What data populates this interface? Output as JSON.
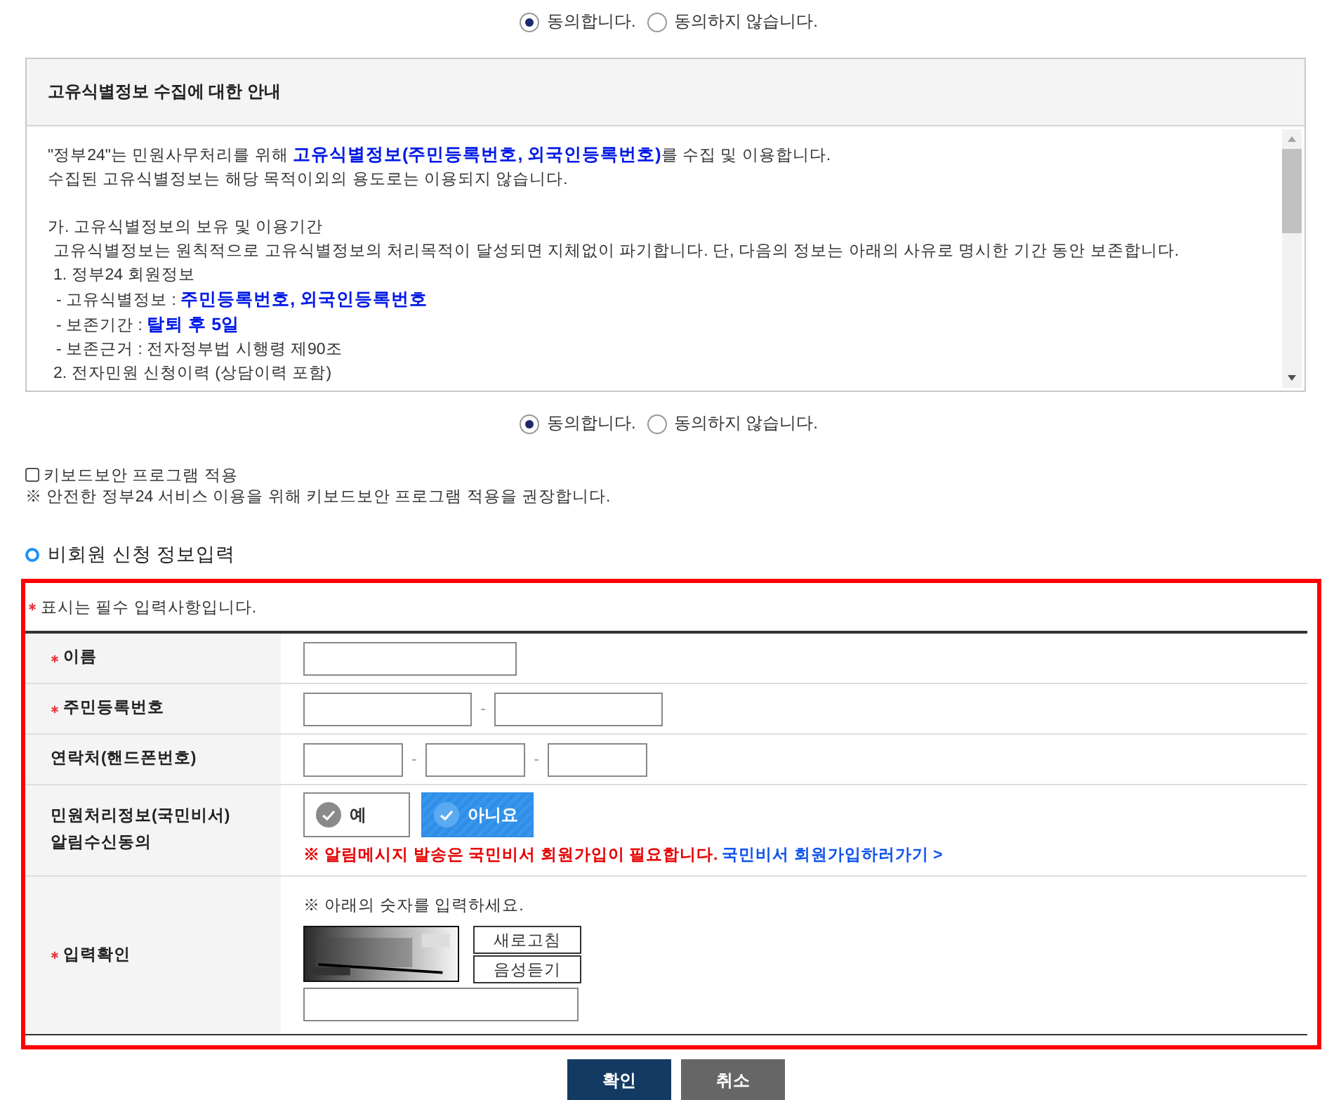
{
  "consent_top": {
    "options": [
      {
        "label": "동의합니다.",
        "selected": true
      },
      {
        "label": "동의하지 않습니다.",
        "selected": false
      }
    ]
  },
  "notice": {
    "title": "고유식별정보 수집에 대한 안내",
    "paragraphs": [
      {
        "lines": [
          {
            "kind": "plain",
            "text": "\"정부24\"는 민원사무처리를 위해 **고유식별정보(주민등록번호, 외국인등록번호)**를 수집 및 이용합니다."
          },
          {
            "kind": "plain",
            "text": "수집된 고유식별정보는 해당 목적이외의 용도로는 이용되지 않습니다."
          }
        ]
      },
      {
        "lines": [
          {
            "kind": "plain",
            "text": "가. 고유식별정보의 보유 및 이용기간"
          },
          {
            "kind": "indent",
            "text": "고유식별정보는 원칙적으로 고유식별정보의 처리목적이 달성되면 지체없이 파기합니다. 단, 다음의 정보는 아래의 사유로 명시한 기간 동안 보존합니다."
          },
          {
            "kind": "indent",
            "text": "1. 정부24 회원정보"
          },
          {
            "kind": "sub",
            "text": "- 고유식별정보 : **주민등록번호, 외국인등록번호**"
          },
          {
            "kind": "sub",
            "text": "- 보존기간 : **탈퇴 후 5일**"
          },
          {
            "kind": "sub",
            "text": "- 보존근거 : 전자정부법 시행령 제90조"
          },
          {
            "kind": "indent",
            "text": "2. 전자민원 신청이력 (상담이력 포함)"
          }
        ]
      }
    ]
  },
  "consent_bottom": {
    "options": [
      {
        "label": "동의합니다.",
        "selected": true
      },
      {
        "label": "동의하지 않습니다.",
        "selected": false
      }
    ]
  },
  "keyboard_security": {
    "label": "키보드보안 프로그램 적용",
    "checked": false,
    "note": "※ 안전한 정부24 서비스 이용을 위해 키보드보안 프로그램 적용을 권장합니다."
  },
  "section_title": "비회원 신청 정보입력",
  "form": {
    "required_note": "표시는 필수 입력사항입니다.",
    "rows": [
      {
        "kind": "name",
        "label": "이름",
        "required": true,
        "parts": [
          {
            "kind": "input"
          }
        ]
      },
      {
        "kind": "rrn",
        "label": "주민등록번호",
        "required": true,
        "parts": [
          {
            "kind": "input"
          },
          {
            "kind": "separator",
            "text": "-"
          },
          {
            "kind": "input"
          }
        ]
      },
      {
        "kind": "phone",
        "label": "연락처(핸드폰번호)",
        "required": false,
        "parts": [
          {
            "kind": "input"
          },
          {
            "kind": "separator",
            "text": "-"
          },
          {
            "kind": "input"
          },
          {
            "kind": "separator",
            "text": "-"
          },
          {
            "kind": "input"
          }
        ]
      },
      {
        "kind": "choice",
        "label": "민원처리정보(국민비서)\n알림수신동의",
        "required": false,
        "options": [
          {
            "label": "예",
            "selected": false
          },
          {
            "label": "아니요",
            "selected": true
          }
        ],
        "warning": "※ 알림메시지 발송은 국민비서 회원가입이 필요합니다.",
        "link": "국민비서 회원가입하러가기 >"
      },
      {
        "kind": "captcha",
        "label": "입력확인",
        "required": true,
        "hint": "※ 아래의 숫자를 입력하세요.",
        "image": {
          "kind": "picture"
        },
        "buttons": [
          "새로고침",
          "음성듣기"
        ]
      }
    ]
  },
  "actions": [
    {
      "label": "확인",
      "kind": "primary"
    },
    {
      "label": "취소",
      "kind": "secondary"
    }
  ]
}
